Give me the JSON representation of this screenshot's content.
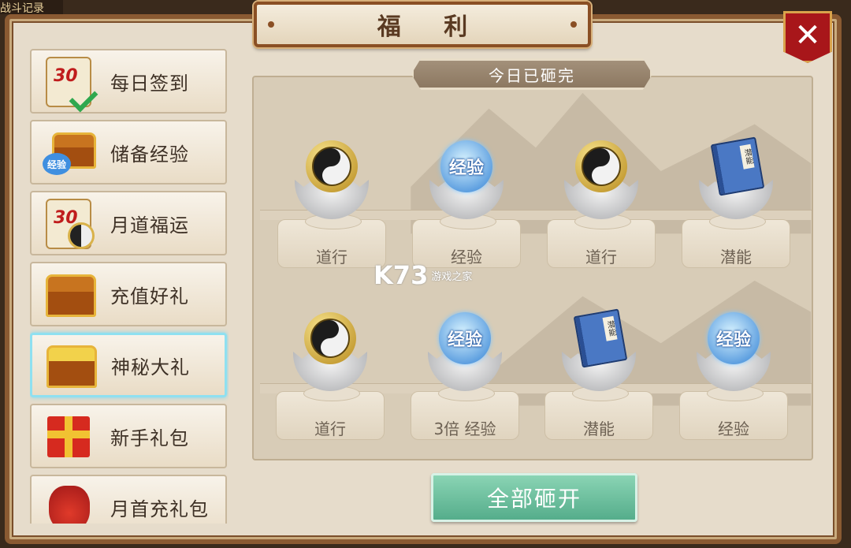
{
  "corner_tag": "战斗记录",
  "title": "福 利",
  "close_label": "✕",
  "sidebar": {
    "items": [
      {
        "label": "每日签到",
        "icon": "calendar-check-icon",
        "badge": "30"
      },
      {
        "label": "储备经验",
        "icon": "exp-chest-icon",
        "badge": "经验"
      },
      {
        "label": "月道福运",
        "icon": "calendar-taiji-icon",
        "badge": "30"
      },
      {
        "label": "充值好礼",
        "icon": "treasure-chest-icon"
      },
      {
        "label": "神秘大礼",
        "icon": "mystery-chest-icon",
        "active": true
      },
      {
        "label": "新手礼包",
        "icon": "gift-box-icon"
      },
      {
        "label": "月首充礼包",
        "icon": "red-bag-icon"
      }
    ]
  },
  "status_text": "今日已砸完",
  "rewards": [
    {
      "name": "道行",
      "type": "taiji"
    },
    {
      "name": "经验",
      "type": "exp",
      "orb_text": "经验"
    },
    {
      "name": "道行",
      "type": "taiji"
    },
    {
      "name": "潜能",
      "type": "book",
      "book_text": "潜能"
    },
    {
      "name": "道行",
      "type": "taiji"
    },
    {
      "name": "3倍 经验",
      "type": "exp",
      "orb_text": "经验"
    },
    {
      "name": "潜能",
      "type": "book",
      "book_text": "潜能"
    },
    {
      "name": "经验",
      "type": "exp",
      "orb_text": "经验"
    }
  ],
  "open_all_label": "全部砸开",
  "watermark": {
    "big": "K73",
    "small": "游戏之家"
  },
  "colors": {
    "panel_bg": "#e6dccb",
    "frame": "#8a5a32",
    "button_green": "#55ad8b",
    "active_border": "#8fe0f0",
    "close_red": "#a8161a"
  }
}
